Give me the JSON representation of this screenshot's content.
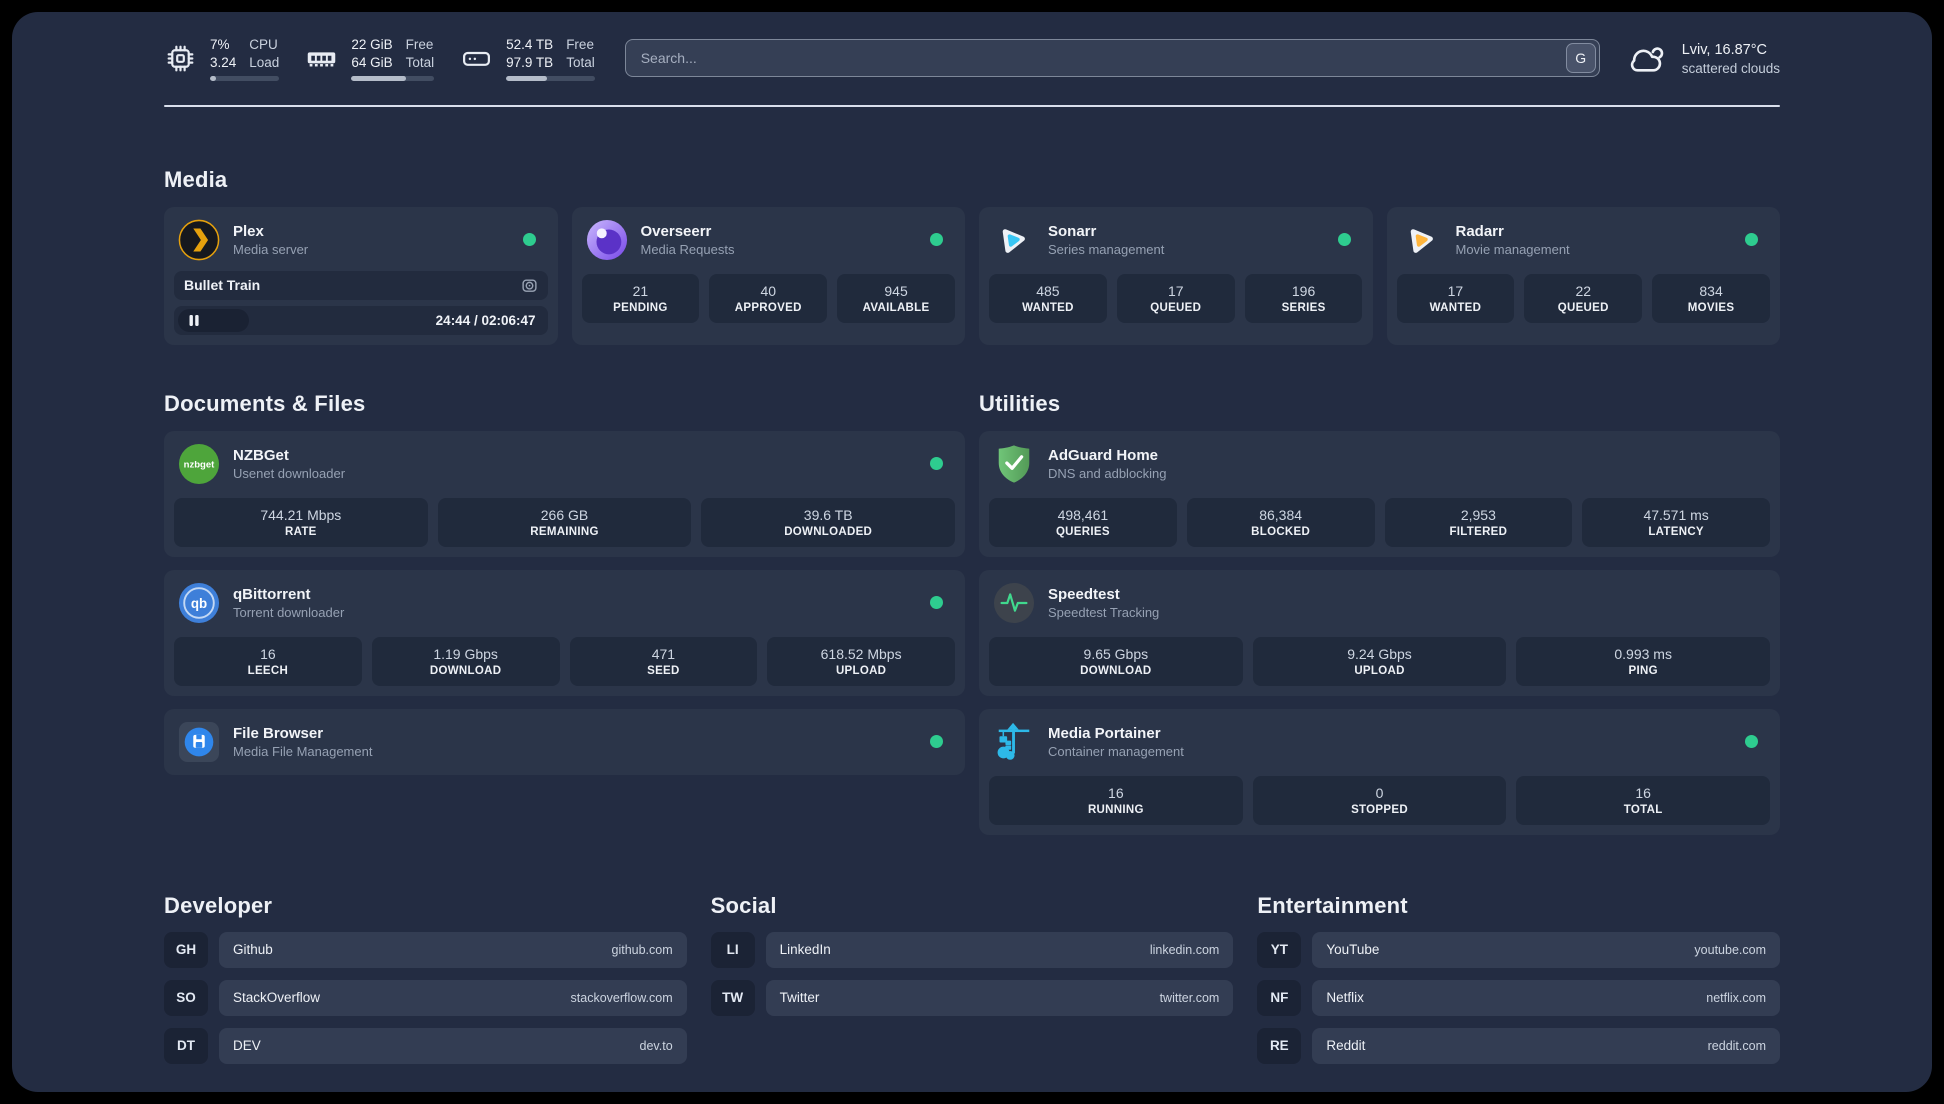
{
  "header": {
    "stats": [
      {
        "icon": "cpu-icon",
        "value1": "7%",
        "value2": "3.24",
        "label1": "CPU",
        "label2": "Load",
        "progress_pct": 8
      },
      {
        "icon": "memory-icon",
        "value1": "22 GiB",
        "value2": "64 GiB",
        "label1": "Free",
        "label2": "Total",
        "progress_pct": 66
      },
      {
        "icon": "disk-icon",
        "value1": "52.4 TB",
        "value2": "97.9 TB",
        "label1": "Free",
        "label2": "Total",
        "progress_pct": 46
      }
    ],
    "search": {
      "placeholder": "Search...",
      "provider_button": "G"
    },
    "weather": {
      "location": "Lviv, 16.87°C",
      "condition": "scattered clouds"
    }
  },
  "sections": {
    "media": "Media",
    "documents": "Documents & Files",
    "utilities": "Utilities",
    "developer": "Developer",
    "social": "Social",
    "entertainment": "Entertainment"
  },
  "services": {
    "plex": {
      "name": "Plex",
      "description": "Media server",
      "now_playing": "Bullet Train",
      "time": "24:44 / 02:06:47"
    },
    "overseerr": {
      "name": "Overseerr",
      "description": "Media Requests",
      "stats": [
        {
          "value": "21",
          "label": "PENDING"
        },
        {
          "value": "40",
          "label": "APPROVED"
        },
        {
          "value": "945",
          "label": "AVAILABLE"
        }
      ]
    },
    "sonarr": {
      "name": "Sonarr",
      "description": "Series management",
      "stats": [
        {
          "value": "485",
          "label": "WANTED"
        },
        {
          "value": "17",
          "label": "QUEUED"
        },
        {
          "value": "196",
          "label": "SERIES"
        }
      ]
    },
    "radarr": {
      "name": "Radarr",
      "description": "Movie management",
      "stats": [
        {
          "value": "17",
          "label": "WANTED"
        },
        {
          "value": "22",
          "label": "QUEUED"
        },
        {
          "value": "834",
          "label": "MOVIES"
        }
      ]
    },
    "nzbget": {
      "name": "NZBGet",
      "description": "Usenet downloader",
      "stats": [
        {
          "value": "744.21 Mbps",
          "label": "RATE"
        },
        {
          "value": "266 GB",
          "label": "REMAINING"
        },
        {
          "value": "39.6 TB",
          "label": "DOWNLOADED"
        }
      ]
    },
    "qbittorrent": {
      "name": "qBittorrent",
      "description": "Torrent downloader",
      "stats": [
        {
          "value": "16",
          "label": "LEECH"
        },
        {
          "value": "1.19 Gbps",
          "label": "DOWNLOAD"
        },
        {
          "value": "471",
          "label": "SEED"
        },
        {
          "value": "618.52 Mbps",
          "label": "UPLOAD"
        }
      ]
    },
    "filebrowser": {
      "name": "File Browser",
      "description": "Media File Management"
    },
    "adguard": {
      "name": "AdGuard Home",
      "description": "DNS and adblocking",
      "stats": [
        {
          "value": "498,461",
          "label": "QUERIES"
        },
        {
          "value": "86,384",
          "label": "BLOCKED"
        },
        {
          "value": "2,953",
          "label": "FILTERED"
        },
        {
          "value": "47.571 ms",
          "label": "LATENCY"
        }
      ]
    },
    "speedtest": {
      "name": "Speedtest",
      "description": "Speedtest Tracking",
      "stats": [
        {
          "value": "9.65 Gbps",
          "label": "DOWNLOAD"
        },
        {
          "value": "9.24 Gbps",
          "label": "UPLOAD"
        },
        {
          "value": "0.993 ms",
          "label": "PING"
        }
      ]
    },
    "portainer": {
      "name": "Media Portainer",
      "description": "Container management",
      "stats": [
        {
          "value": "16",
          "label": "RUNNING"
        },
        {
          "value": "0",
          "label": "STOPPED"
        },
        {
          "value": "16",
          "label": "TOTAL"
        }
      ]
    }
  },
  "bookmarks": {
    "developer": [
      {
        "abbr": "GH",
        "name": "Github",
        "domain": "github.com"
      },
      {
        "abbr": "SO",
        "name": "StackOverflow",
        "domain": "stackoverflow.com"
      },
      {
        "abbr": "DT",
        "name": "DEV",
        "domain": "dev.to"
      }
    ],
    "social": [
      {
        "abbr": "LI",
        "name": "LinkedIn",
        "domain": "linkedin.com"
      },
      {
        "abbr": "TW",
        "name": "Twitter",
        "domain": "twitter.com"
      }
    ],
    "entertainment": [
      {
        "abbr": "YT",
        "name": "YouTube",
        "domain": "youtube.com"
      },
      {
        "abbr": "NF",
        "name": "Netflix",
        "domain": "netflix.com"
      },
      {
        "abbr": "RE",
        "name": "Reddit",
        "domain": "reddit.com"
      }
    ]
  },
  "colors": {
    "status_online": "#2ecc8f",
    "panel_bg": "#232c42",
    "card_bg": "#2b3549"
  }
}
